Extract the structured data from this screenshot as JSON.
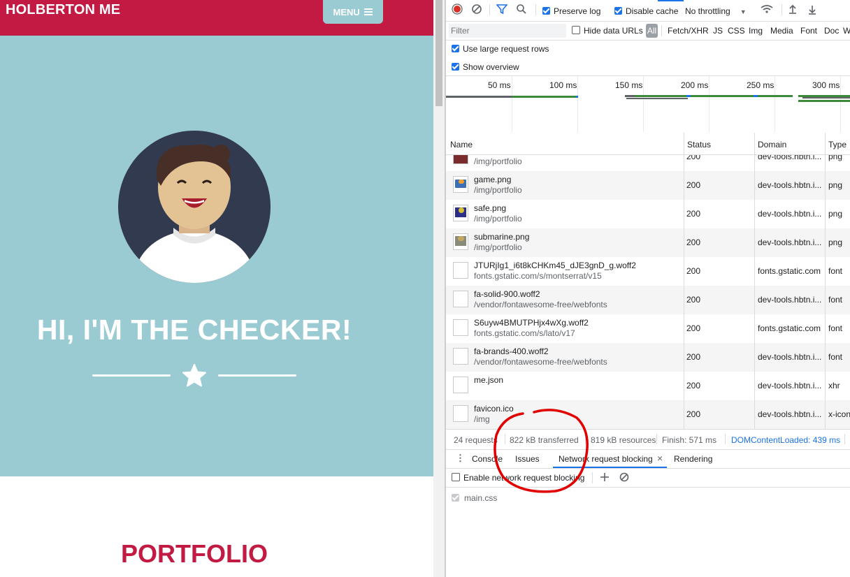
{
  "site": {
    "brand": "HOLBERTON ME",
    "menu_label": "MENU",
    "hero_title": "HI, I'M THE CHECKER!",
    "section_title": "PORTFOLIO"
  },
  "devtools": {
    "toolbar": {
      "preserve_log": "Preserve log",
      "disable_cache": "Disable cache",
      "throttling": "No throttling"
    },
    "filter": {
      "placeholder": "Filter",
      "hide_data_urls": "Hide data URLs",
      "all": "All",
      "types": [
        "Fetch/XHR",
        "JS",
        "CSS",
        "Img",
        "Media",
        "Font",
        "Doc",
        "W"
      ]
    },
    "options": {
      "large_rows": "Use large request rows",
      "show_overview": "Show overview"
    },
    "timeline_ticks": [
      "50 ms",
      "100 ms",
      "150 ms",
      "200 ms",
      "250 ms",
      "300 ms"
    ],
    "columns": [
      "Name",
      "Status",
      "Domain",
      "Type"
    ],
    "requests": [
      {
        "name": "",
        "path": "/img/portfolio",
        "status": "200",
        "domain": "dev-tools.hbtn.i...",
        "type": "png"
      },
      {
        "name": "game.png",
        "path": "/img/portfolio",
        "status": "200",
        "domain": "dev-tools.hbtn.i...",
        "type": "png"
      },
      {
        "name": "safe.png",
        "path": "/img/portfolio",
        "status": "200",
        "domain": "dev-tools.hbtn.i...",
        "type": "png"
      },
      {
        "name": "submarine.png",
        "path": "/img/portfolio",
        "status": "200",
        "domain": "dev-tools.hbtn.i...",
        "type": "png"
      },
      {
        "name": "JTURjIg1_i6t8kCHKm45_dJE3gnD_g.woff2",
        "path": "fonts.gstatic.com/s/montserrat/v15",
        "status": "200",
        "domain": "fonts.gstatic.com",
        "type": "font"
      },
      {
        "name": "fa-solid-900.woff2",
        "path": "/vendor/fontawesome-free/webfonts",
        "status": "200",
        "domain": "dev-tools.hbtn.i...",
        "type": "font"
      },
      {
        "name": "S6uyw4BMUTPHjx4wXg.woff2",
        "path": "fonts.gstatic.com/s/lato/v17",
        "status": "200",
        "domain": "fonts.gstatic.com",
        "type": "font"
      },
      {
        "name": "fa-brands-400.woff2",
        "path": "/vendor/fontawesome-free/webfonts",
        "status": "200",
        "domain": "dev-tools.hbtn.i...",
        "type": "font"
      },
      {
        "name": "me.json",
        "path": "",
        "status": "200",
        "domain": "dev-tools.hbtn.i...",
        "type": "xhr"
      },
      {
        "name": "favicon.ico",
        "path": "/img",
        "status": "200",
        "domain": "dev-tools.hbtn.i...",
        "type": "x-icon"
      }
    ],
    "summary": {
      "requests": "24 requests",
      "transferred": "822 kB transferred",
      "resources": "819 kB resources",
      "finish": "Finish: 571 ms",
      "dcl": "DOMContentLoaded: 439 ms"
    },
    "drawer_tabs": [
      "Console",
      "Issues",
      "Network request blocking",
      "Rendering"
    ],
    "blocking": {
      "enable_label": "Enable network request blocking",
      "patterns": [
        "main.css"
      ]
    },
    "colors": {
      "accent": "#1a73e8",
      "brand": "#c21a42",
      "hero_bg": "#9bcbd2",
      "annotation": "#e00000"
    }
  }
}
